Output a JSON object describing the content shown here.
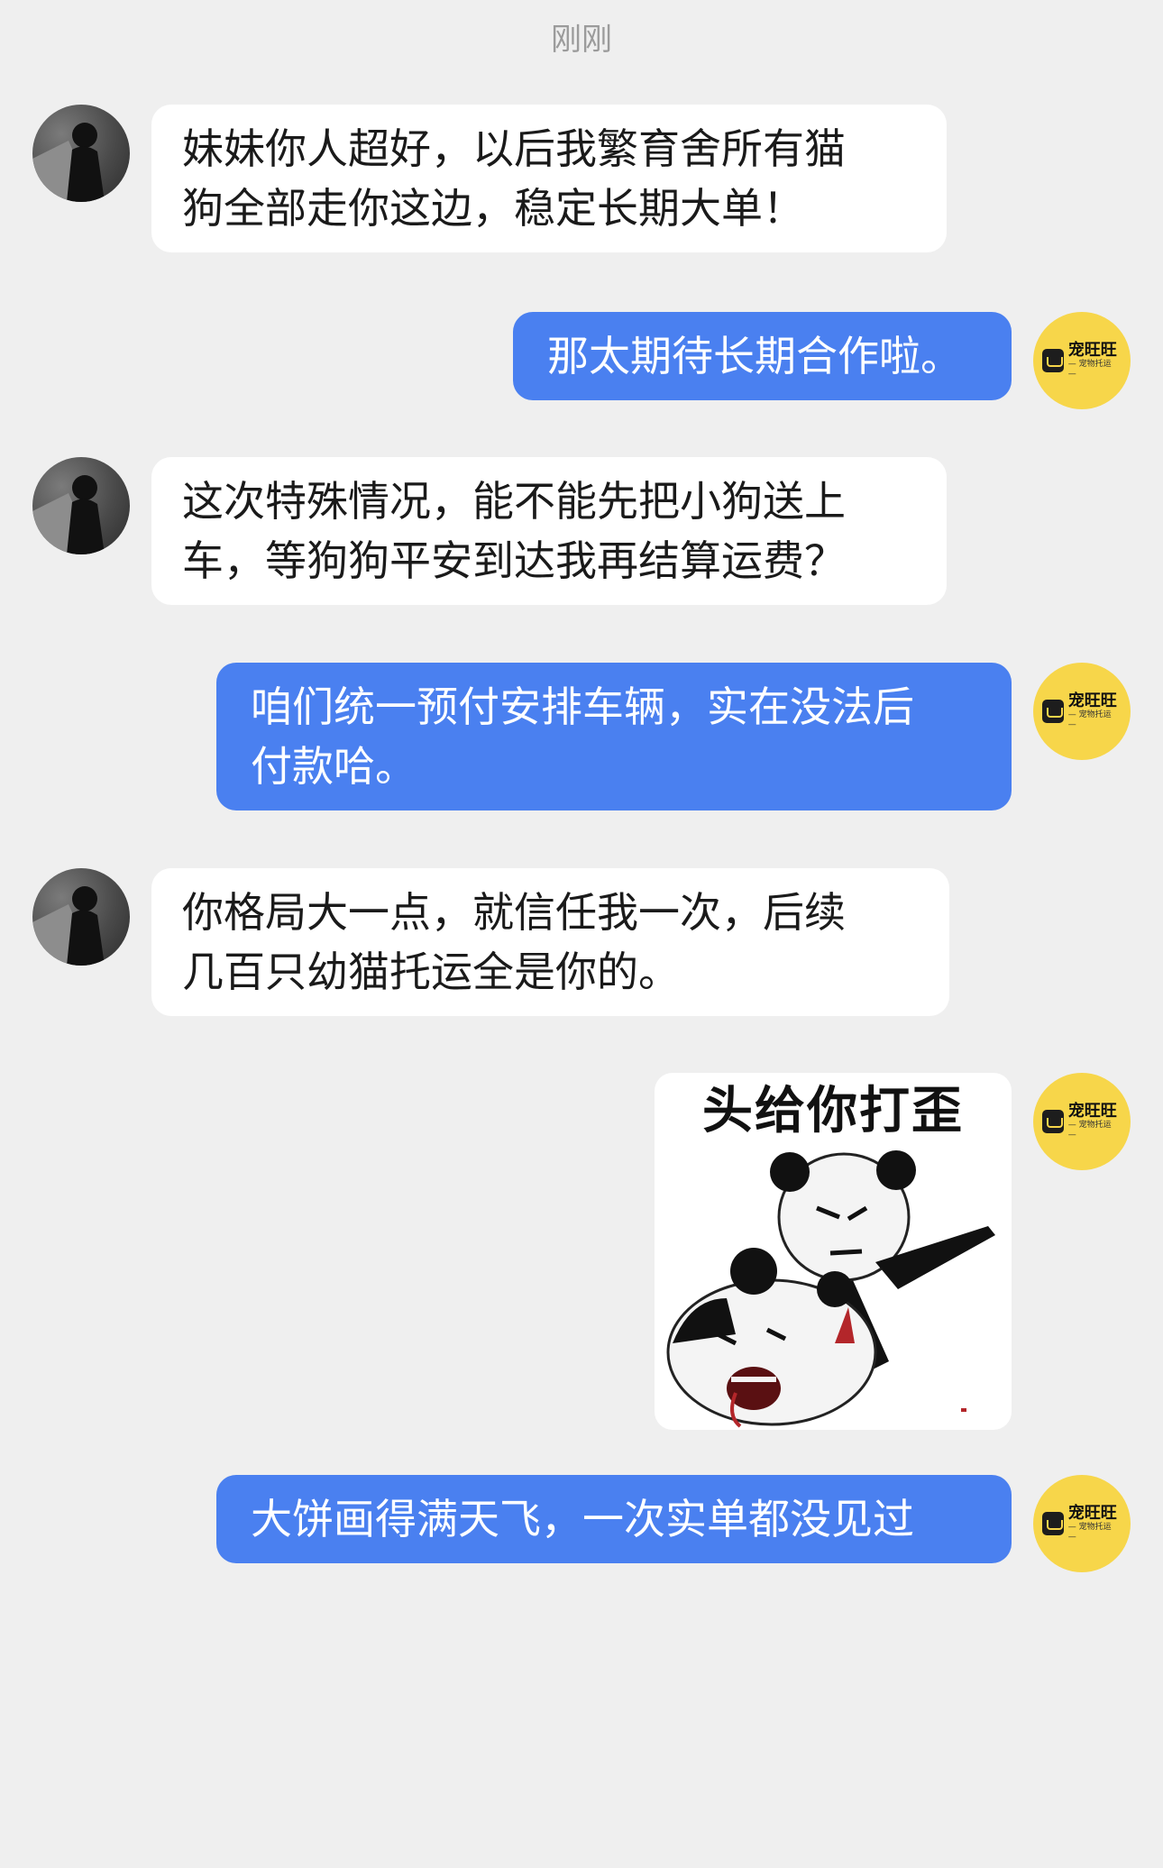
{
  "chat": {
    "timestamp": "刚刚",
    "messages": [
      {
        "from": "peer",
        "text": [
          "妹妹你人超好，以后我繁育舍所有猫",
          "狗全部走你这边，稳定长期大单！"
        ]
      },
      {
        "from": "me",
        "text": [
          "那太期待长期合作啦。"
        ]
      },
      {
        "from": "peer",
        "text": [
          "这次特殊情况，能不能先把小狗送上",
          "车，等狗狗平安到达我再结算运费？"
        ]
      },
      {
        "from": "me",
        "text": [
          "咱们统一预付安排车辆，实在没法后",
          "付款哈。"
        ]
      },
      {
        "from": "peer",
        "text": [
          "你格局大一点，就信任我一次，后续",
          "几百只幼猫托运全是你的。"
        ]
      },
      {
        "from": "me",
        "type": "image",
        "caption": "头给你打歪",
        "icon": "panda-meme-image"
      },
      {
        "from": "me",
        "text": [
          "大饼画得满天飞，一次实单都没见过"
        ]
      }
    ]
  },
  "me_avatar": {
    "logo_main": "宠旺旺",
    "logo_sub": "— 宠物托运 —",
    "bg_color": "#f7d64a"
  },
  "peer_avatar": {
    "icon": "silhouette-avatar"
  },
  "colors": {
    "background": "#efefef",
    "me_bubble": "#4a80f0",
    "peer_bubble": "#ffffff"
  }
}
